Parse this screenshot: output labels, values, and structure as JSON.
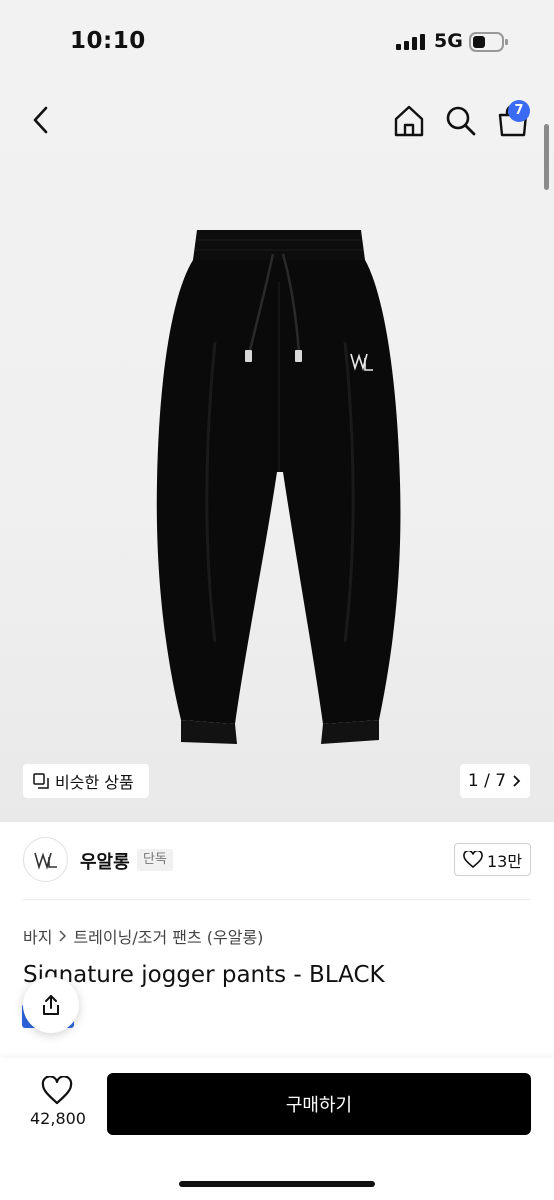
{
  "status_bar": {
    "time": "10:10",
    "network": "5G"
  },
  "nav": {
    "cart_count": "7"
  },
  "gallery": {
    "similar_label": "비슷한 상품",
    "page_indicator": "1 / 7"
  },
  "brand": {
    "name": "우알롱",
    "badge": "단독",
    "like_count": "13만"
  },
  "breadcrumb": {
    "level1": "바지",
    "level2": "트레이닝/조거 팬츠 (우알롱)"
  },
  "product": {
    "title": "Signature jogger pants - BLACK"
  },
  "bottom_bar": {
    "like_count": "42,800",
    "buy_label": "구매하기"
  },
  "colors": {
    "accent": "#3a6bf2",
    "buy_button": "#000000"
  }
}
